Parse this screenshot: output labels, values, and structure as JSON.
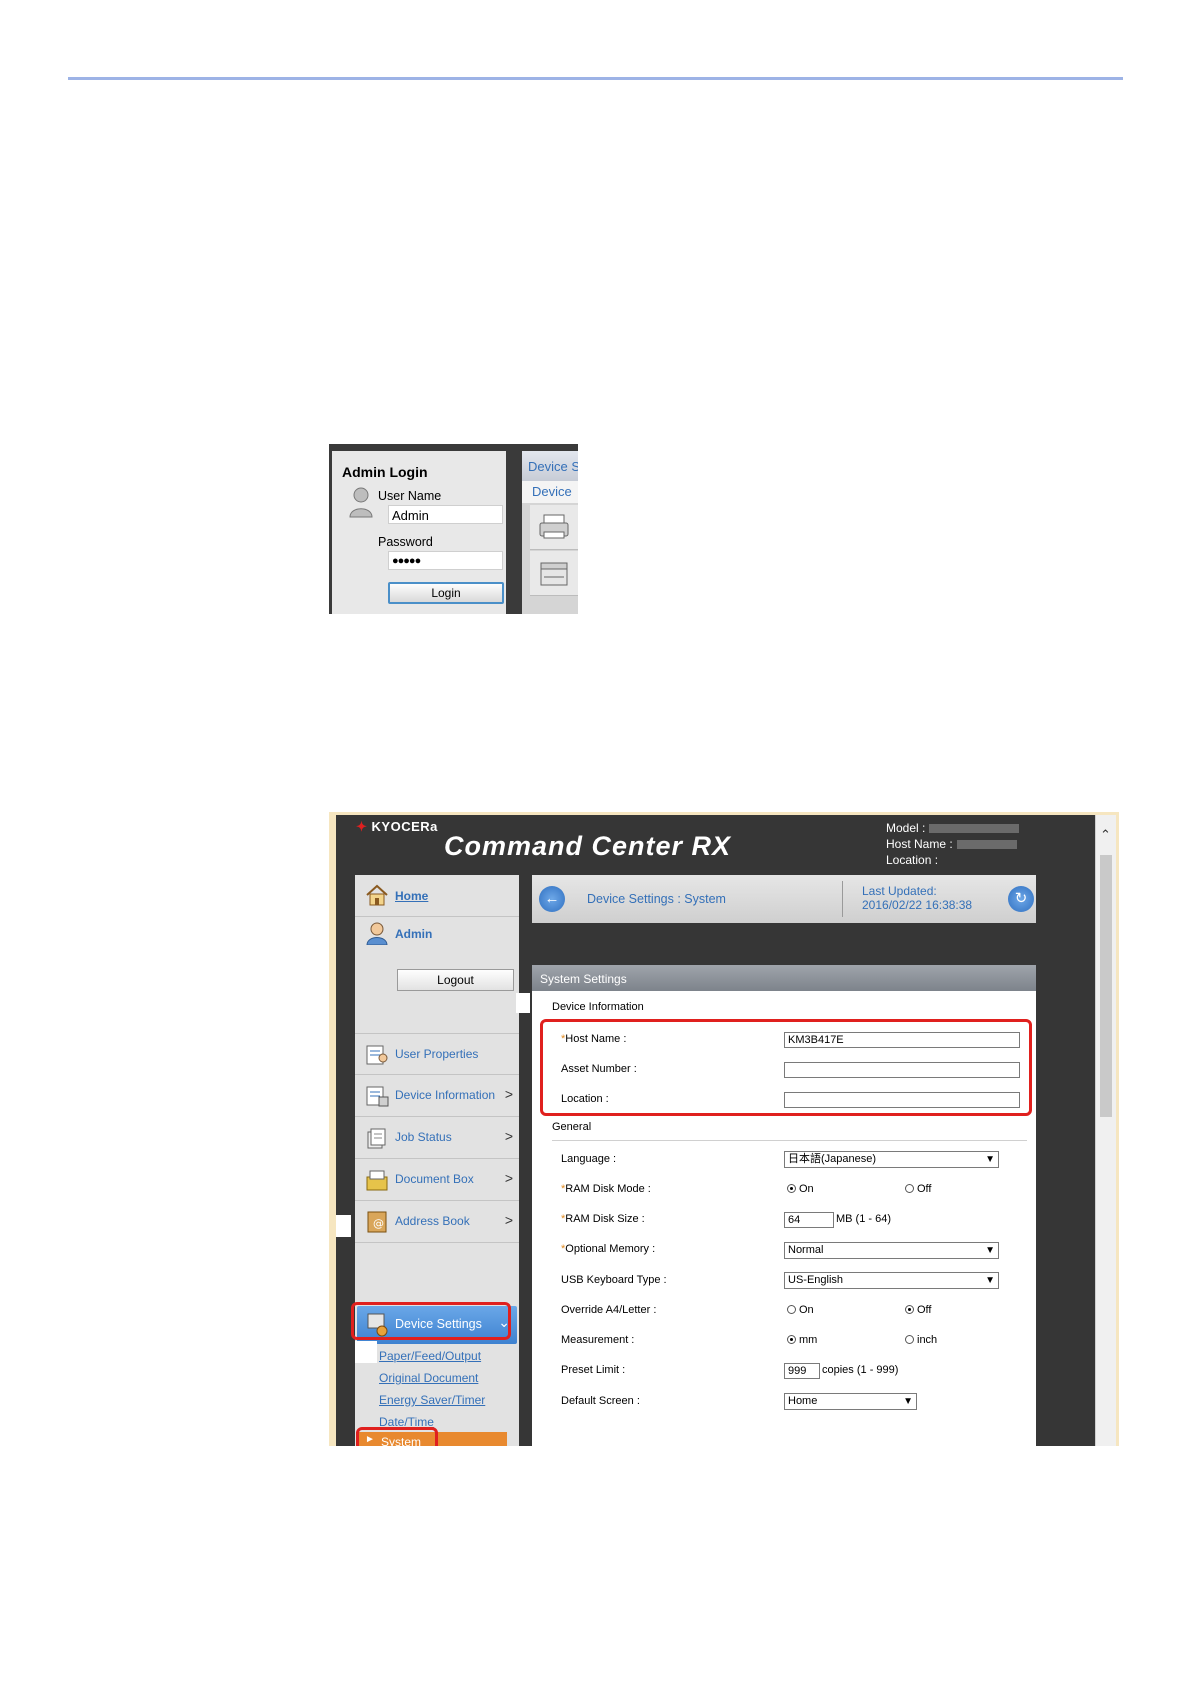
{
  "login": {
    "title": "Admin Login",
    "username_label": "User Name",
    "username_value": "Admin",
    "password_label": "Password",
    "password_value": "●●●●●",
    "login_button": "Login",
    "right_tab": "Device S",
    "right_sub": "Device"
  },
  "header": {
    "logo_text": "KYOCERa",
    "app_title": "Command Center RX",
    "model_label": "Model :",
    "host_label": "Host Name :",
    "location_label": "Location :"
  },
  "nav": {
    "home": "Home",
    "user": "Admin",
    "logout": "Logout",
    "items": [
      {
        "label": "User Properties"
      },
      {
        "label": "Device Information"
      },
      {
        "label": "Job Status"
      },
      {
        "label": "Document Box"
      },
      {
        "label": "Address Book"
      }
    ],
    "device_settings": "Device Settings",
    "sub_items": [
      "Paper/Feed/Output",
      "Original Document",
      "Energy Saver/Timer",
      "Date/Time"
    ],
    "system": "System"
  },
  "crumb": {
    "path": "Device Settings : System",
    "updated_label": "Last Updated:",
    "updated_value": "2016/02/22 16:38:38"
  },
  "panel": {
    "title": "System Settings",
    "device_info": "Device Information",
    "host_name_label": "Host Name :",
    "host_name_value": "KM3B417E",
    "asset_label": "Asset Number :",
    "asset_value": "",
    "location_label": "Location :",
    "location_value": "",
    "general": "General",
    "language_label": "Language :",
    "language_value": "日本語(Japanese)",
    "ram_mode_label": "RAM Disk Mode :",
    "on": "On",
    "off": "Off",
    "ram_size_label": "RAM Disk Size :",
    "ram_size_value": "64",
    "ram_size_unit": "MB (1 - 64)",
    "opt_mem_label": "Optional Memory :",
    "opt_mem_value": "Normal",
    "usb_label": "USB Keyboard Type :",
    "usb_value": "US-English",
    "override_label": "Override A4/Letter :",
    "measurement_label": "Measurement :",
    "mm": "mm",
    "inch": "inch",
    "preset_label": "Preset Limit :",
    "preset_value": "999",
    "preset_unit": "copies (1 - 999)",
    "default_screen_label": "Default Screen :",
    "default_screen_value": "Home"
  },
  "colors": {
    "highlight_red": "#e0201e",
    "link_blue": "#3470b8",
    "selected_orange": "#e8892f",
    "top_rule": "#9db3e6"
  }
}
